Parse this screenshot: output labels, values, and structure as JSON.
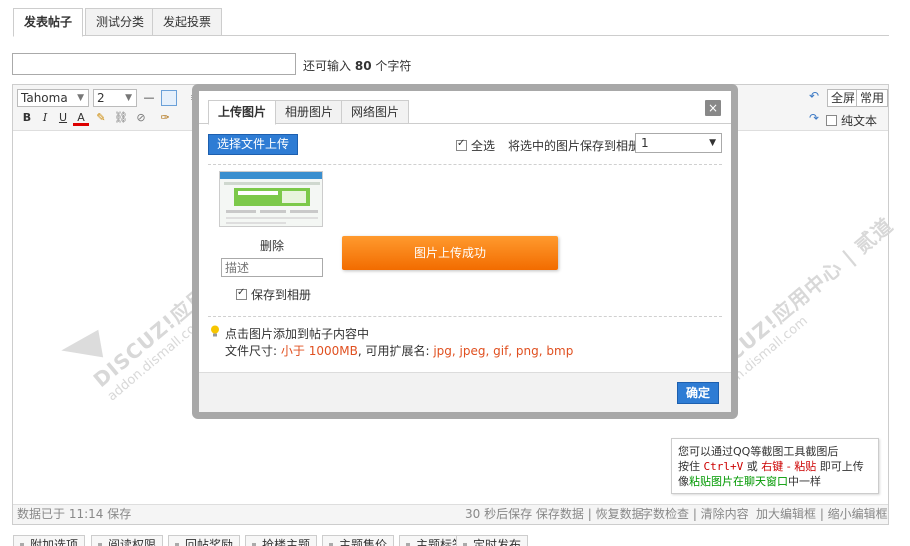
{
  "top_tabs": [
    {
      "label": "发表帖子",
      "active": true
    },
    {
      "label": "测试分类",
      "active": false
    },
    {
      "label": "发起投票",
      "active": false
    }
  ],
  "subject": {
    "value": "",
    "hint_prefix": "还可输入",
    "hint_count": "80",
    "hint_suffix": "个字符"
  },
  "editor": {
    "font_name": "Tahoma",
    "font_size": "2",
    "toolbar_right": {
      "fullscreen": "全屏",
      "common": "常用",
      "plain_text": "纯文本"
    },
    "status": {
      "saved": "数据已于 11:14 保存",
      "autosave": "30 秒后保存 保存数据 | 恢复数据",
      "check": "字数检查 | 清除内容",
      "resize": "加大编辑框 | 缩小编辑框"
    }
  },
  "watermark": {
    "brand": "DISCUZ!应用中心 | 贰道",
    "url": "addon.dismall.com"
  },
  "tip_box": {
    "line1": "您可以通过QQ等截图工具截图后",
    "line2_a": "按住",
    "line2_keys": "Ctrl+V",
    "line2_b": "或",
    "line2_right": "右键 - 粘贴",
    "line2_c": "即可上传",
    "line3_a": "像",
    "line3_green": "粘贴图片在聊天窗口",
    "line3_b": "中一样"
  },
  "bottom_tabs": [
    "附加选项",
    "阅读权限",
    "回帖奖励",
    "抢楼主题",
    "主题售价",
    "主题标签",
    "定时发布"
  ],
  "dialog": {
    "tabs": [
      {
        "label": "上传图片",
        "active": true
      },
      {
        "label": "相册图片",
        "active": false
      },
      {
        "label": "网络图片",
        "active": false
      }
    ],
    "close_label": "×",
    "upload_button": "选择文件上传",
    "select_all": "全选",
    "save_to_album_label": "将选中的图片保存到相册:",
    "album_value": "1",
    "delete_label": "删除",
    "desc_placeholder": "描述",
    "save_to_album": "保存到相册",
    "success_text": "图片上传成功",
    "hint_click": "点击图片添加到帖子内容中",
    "file_size_label": "文件尺寸:",
    "file_size_value": "小于 1000MB",
    "ext_label": ", 可用扩展名:",
    "ext_value": "jpg, jpeg, gif, png, bmp",
    "ok_button": "确定"
  },
  "colors": {
    "accent_blue": "#2e7cd4",
    "success_orange": "#f57c00",
    "hint_red": "#e05020"
  }
}
